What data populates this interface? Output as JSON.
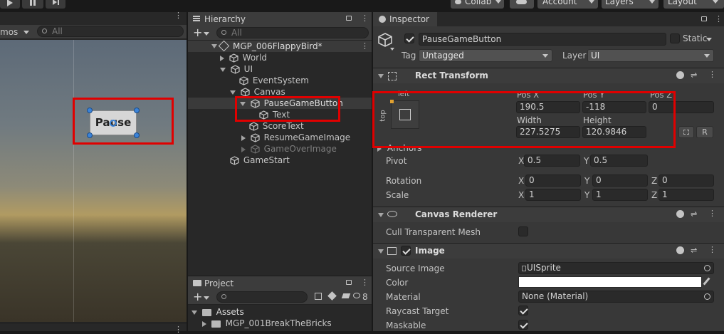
{
  "toolbar": {
    "collab": "Collab",
    "account": "Account",
    "layers": "Layers",
    "layout": "Layout"
  },
  "scene": {
    "gizmos": "mos",
    "search_placeholder": "All",
    "button_text": "Pause"
  },
  "hierarchy": {
    "title": "Hierarchy",
    "search_placeholder": "All",
    "scene_name": "MGP_006FlappyBird*",
    "items": [
      {
        "label": "World"
      },
      {
        "label": "UI"
      },
      {
        "label": "EventSystem"
      },
      {
        "label": "Canvas"
      },
      {
        "label": "PauseGameButton"
      },
      {
        "label": "Text"
      },
      {
        "label": "ScoreText"
      },
      {
        "label": "ResumeGameImage"
      },
      {
        "label": "GameOverImage"
      },
      {
        "label": "GameStart"
      }
    ]
  },
  "project": {
    "title": "Project",
    "hidden_count": "8",
    "items": [
      {
        "label": "Assets"
      },
      {
        "label": "MGP_001BreakTheBricks"
      }
    ]
  },
  "inspector": {
    "title": "Inspector",
    "object_name": "PauseGameButton",
    "static_label": "Static",
    "tag_label": "Tag",
    "tag_value": "Untagged",
    "layer_label": "Layer",
    "layer_value": "UI",
    "rect_transform": {
      "title": "Rect Transform",
      "anchor_left": "left",
      "anchor_top": "top",
      "pos_x_label": "Pos X",
      "pos_y_label": "Pos Y",
      "pos_z_label": "Pos Z",
      "pos_x": "190.5",
      "pos_y": "-118",
      "pos_z": "0",
      "width_label": "Width",
      "height_label": "Height",
      "width": "227.5275",
      "height": "120.9846",
      "r_button": "R",
      "anchors_label": "Anchors",
      "pivot_label": "Pivot",
      "pivot_x": "0.5",
      "pivot_y": "0.5",
      "rotation_label": "Rotation",
      "rot_x": "0",
      "rot_y": "0",
      "rot_z": "0",
      "scale_label": "Scale",
      "scale_x": "1",
      "scale_y": "1",
      "scale_z": "1",
      "x": "X",
      "y": "Y",
      "z": "Z"
    },
    "canvas_renderer": {
      "title": "Canvas Renderer",
      "cull_label": "Cull Transparent Mesh"
    },
    "image": {
      "title": "Image",
      "source_label": "Source Image",
      "source_value": "UISprite",
      "color_label": "Color",
      "material_label": "Material",
      "material_value": "None (Material)",
      "raycast_label": "Raycast Target",
      "maskable_label": "Maskable"
    }
  },
  "colors": {
    "highlight_red": "#e00000",
    "selection": "#2c5d87"
  }
}
